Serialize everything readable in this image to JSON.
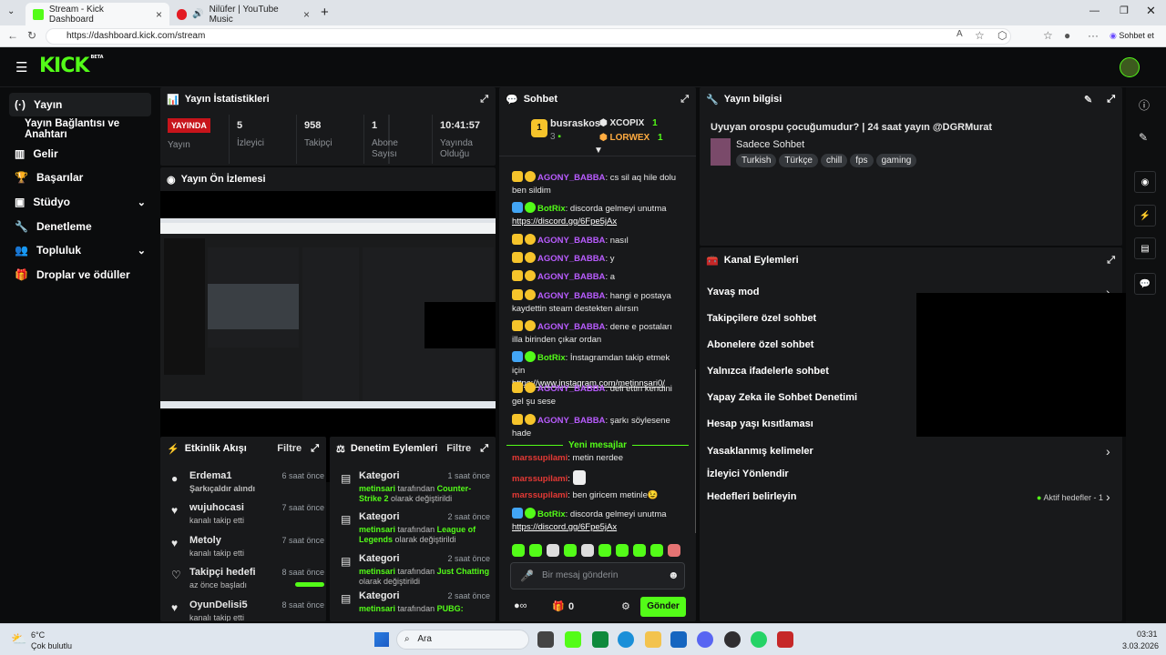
{
  "browser": {
    "tabs": [
      {
        "label": "Stream - Kick Dashboard",
        "active": true
      },
      {
        "label": "Nilüfer | YouTube Music",
        "active": false
      }
    ],
    "url": "https://dashboard.kick.com/stream",
    "copilot_label": "Sohbet et"
  },
  "logo": {
    "text": "KICK",
    "beta": "BETA"
  },
  "sidebar": {
    "items": [
      {
        "label": "Yayın",
        "icon": "broadcast-icon",
        "active": true
      },
      {
        "label": "Yayın Bağlantısı ve Anahtarı",
        "icon": "",
        "active": false
      },
      {
        "label": "Gelir",
        "icon": "chart-icon",
        "active": false
      },
      {
        "label": "Başarılar",
        "icon": "trophy-icon",
        "active": false
      },
      {
        "label": "Stüdyo",
        "icon": "studio-icon",
        "active": false,
        "chevron": true
      },
      {
        "label": "Denetleme",
        "icon": "wrench-icon",
        "active": false
      },
      {
        "label": "Topluluk",
        "icon": "community-icon",
        "active": false,
        "chevron": true
      },
      {
        "label": "Droplar ve ödüller",
        "icon": "gift-icon",
        "active": false
      }
    ]
  },
  "stats": {
    "title": "Yayın İstatistikleri",
    "live_label": "YAYINDA",
    "items": [
      {
        "value": "",
        "label": "Yayın"
      },
      {
        "value": "5",
        "label": "İzleyici"
      },
      {
        "value": "958",
        "label": "Takipçi"
      },
      {
        "value": "1",
        "label": "Abone Sayısı"
      },
      {
        "value": "10:41:57",
        "label": "Yayında Olduğu"
      }
    ]
  },
  "preview": {
    "title": "Yayın Ön İzlemesi"
  },
  "activity": {
    "title": "Etkinlik Akışı",
    "filter": "Filtre",
    "items": [
      {
        "name": "Erdema1",
        "sub": "Şarkıçaldır alındı",
        "time": "6 saat önce",
        "green_sub": true
      },
      {
        "name": "wujuhocasi",
        "sub": "kanalı takip etti",
        "time": "7 saat önce"
      },
      {
        "name": "Metoly",
        "sub": "kanalı takip etti",
        "time": "7 saat önce"
      },
      {
        "name": "Takipçi hedefi",
        "sub": "az önce başladı",
        "time": "8 saat önce",
        "progress": true
      },
      {
        "name": "OyunDelisi5",
        "sub": "kanalı takip etti",
        "time": "8 saat önce"
      }
    ]
  },
  "moderation": {
    "title": "Denetim Eylemleri",
    "filter": "Filtre",
    "items": [
      {
        "title": "Kategori",
        "time": "1 saat önce",
        "user": "metinsari",
        "pre": "tarafından",
        "game": "Counter-Strike 2",
        "post": "olarak değiştirildi"
      },
      {
        "title": "Kategori",
        "time": "2 saat önce",
        "user": "metinsari",
        "pre": "tarafından",
        "game": "League of Legends",
        "post": "olarak değiştirildi"
      },
      {
        "title": "Kategori",
        "time": "2 saat önce",
        "user": "metinsari",
        "pre": "tarafından",
        "game": "Just Chatting",
        "post": "olarak değiştirildi"
      },
      {
        "title": "Kategori",
        "time": "2 saat önce",
        "user": "metinsari",
        "pre": "tarafından",
        "game": "PUBG:",
        "post": ""
      }
    ]
  },
  "chat": {
    "title": "Sohbet",
    "leaders": {
      "top": {
        "name": "busraskos",
        "count": "3",
        "rank": "1"
      },
      "second": [
        {
          "name": "XCOPIX",
          "count": "1"
        },
        {
          "name": "LORWEX",
          "count": "1"
        }
      ]
    },
    "messages": [
      {
        "user": "AGONY_BABBA",
        "text": "cs sil aq hile dolu ben sildim",
        "type": "purple"
      },
      {
        "user": "BotRix",
        "text": "discorda gelmeyi unutma",
        "link": "https://discord.gg/6Fpe5jAx",
        "type": "bot"
      },
      {
        "user": "AGONY_BABBA",
        "text": "nasıl",
        "type": "purple"
      },
      {
        "user": "AGONY_BABBA",
        "text": "y",
        "type": "purple"
      },
      {
        "user": "AGONY_BABBA",
        "text": "a",
        "type": "purple"
      },
      {
        "user": "AGONY_BABBA",
        "text": "hangi e postaya kaydettin steam destekten alırsın",
        "type": "purple"
      },
      {
        "user": "AGONY_BABBA",
        "text": "dene e postaları illa birinden çıkar ordan",
        "type": "purple"
      },
      {
        "user": "BotRix",
        "text": "İnstagramdan takip etmek için",
        "link": "https://www.instagram.com/metinnsari0/",
        "type": "bot"
      },
      {
        "user": "AGONY_BABBA",
        "text": "deli ettin kendini gel şu sese",
        "type": "purple"
      },
      {
        "user": "AGONY_BABBA",
        "text": "şarkı söylesene hade",
        "type": "purple"
      }
    ],
    "new_label": "Yeni mesajlar",
    "new_messages": [
      {
        "user": "marssupilami",
        "text": "metin nerdee",
        "type": "red"
      },
      {
        "user": "marssupilami",
        "text": "",
        "type": "red",
        "emote": true
      },
      {
        "user": "marssupilami",
        "text": "ben giricem metinle😉",
        "type": "red"
      },
      {
        "user": "BotRix",
        "text": "discorda gelmeyi unutma",
        "link": "https://discord.gg/6Fpe5jAx",
        "type": "bot"
      }
    ],
    "input_placeholder": "Bir mesaj gönderin",
    "points": "0",
    "send_label": "Gönder"
  },
  "info": {
    "title": "Yayın bilgisi",
    "stream_title": "Uyuyan orospu çocuğumudur? | 24 saat yayın @DGRMurat",
    "category": "Sadece Sohbet",
    "tags": [
      "Turkish",
      "Türkçe",
      "chill",
      "fps",
      "gaming"
    ]
  },
  "channel": {
    "title": "Kanal Eylemleri",
    "items": [
      {
        "label": "Yavaş mod",
        "chevron": true
      },
      {
        "label": "Takipçilere özel sohbet"
      },
      {
        "label": "Abonelere özel sohbet"
      },
      {
        "label": "Yalnızca ifadelerle sohbet"
      },
      {
        "label": "Yapay Zeka ile Sohbet Denetimi"
      },
      {
        "label": "Hesap yaşı kısıtlaması"
      },
      {
        "label": "Yasaklanmış kelimeler",
        "chevron": true
      },
      {
        "label": "İzleyici Yönlendir"
      },
      {
        "label": "Hedefleri belirleyin",
        "chevron": true
      }
    ],
    "goals_status": "Aktif hedefler - 1"
  },
  "taskbar": {
    "weather_temp": "6°C",
    "weather_desc": "Çok bulutlu",
    "search": "Ara",
    "time": "03:31",
    "date": "3.03.2026"
  },
  "colors": {
    "accent": "#53fc18",
    "live": "#c7141b",
    "panel": "#18191b"
  }
}
